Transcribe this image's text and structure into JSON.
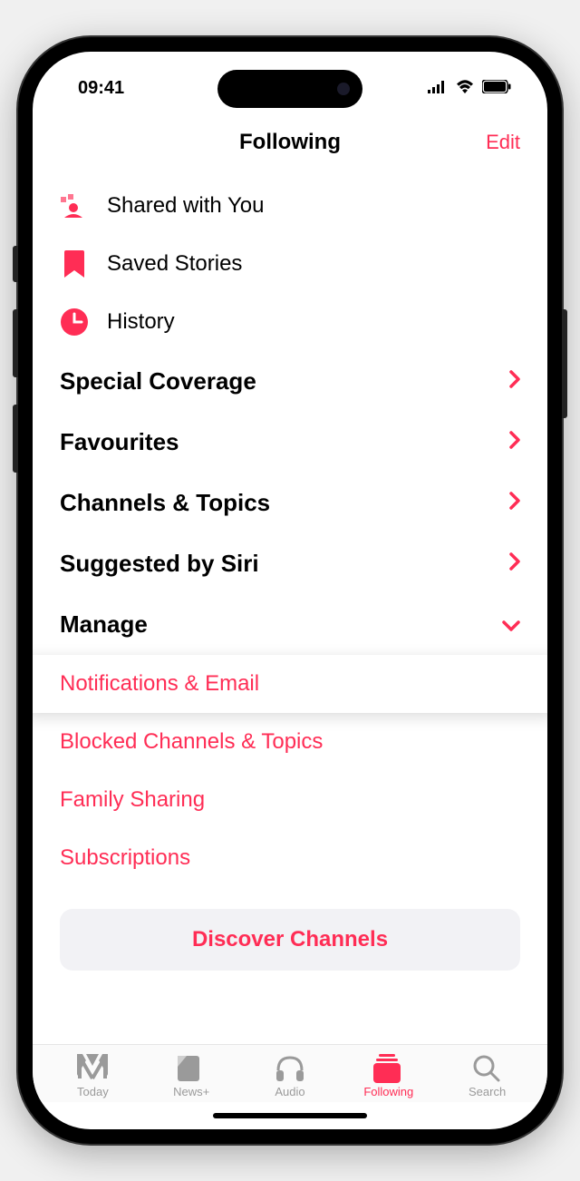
{
  "statusBar": {
    "time": "09:41"
  },
  "header": {
    "title": "Following",
    "edit": "Edit"
  },
  "quickItems": [
    {
      "icon": "shared",
      "label": "Shared with You"
    },
    {
      "icon": "bookmark",
      "label": "Saved Stories"
    },
    {
      "icon": "history",
      "label": "History"
    }
  ],
  "sections": [
    {
      "label": "Special Coverage",
      "chev": "right"
    },
    {
      "label": "Favourites",
      "chev": "right"
    },
    {
      "label": "Channels & Topics",
      "chev": "right"
    },
    {
      "label": "Suggested by Siri",
      "chev": "right"
    },
    {
      "label": "Manage",
      "chev": "down"
    }
  ],
  "manageItems": [
    {
      "label": "Notifications & Email",
      "highlighted": true
    },
    {
      "label": "Blocked Channels & Topics",
      "highlighted": false
    },
    {
      "label": "Family Sharing",
      "highlighted": false
    },
    {
      "label": "Subscriptions",
      "highlighted": false
    }
  ],
  "discoverButton": "Discover Channels",
  "tabs": [
    {
      "label": "Today",
      "active": false
    },
    {
      "label": "News+",
      "active": false
    },
    {
      "label": "Audio",
      "active": false
    },
    {
      "label": "Following",
      "active": true
    },
    {
      "label": "Search",
      "active": false
    }
  ]
}
